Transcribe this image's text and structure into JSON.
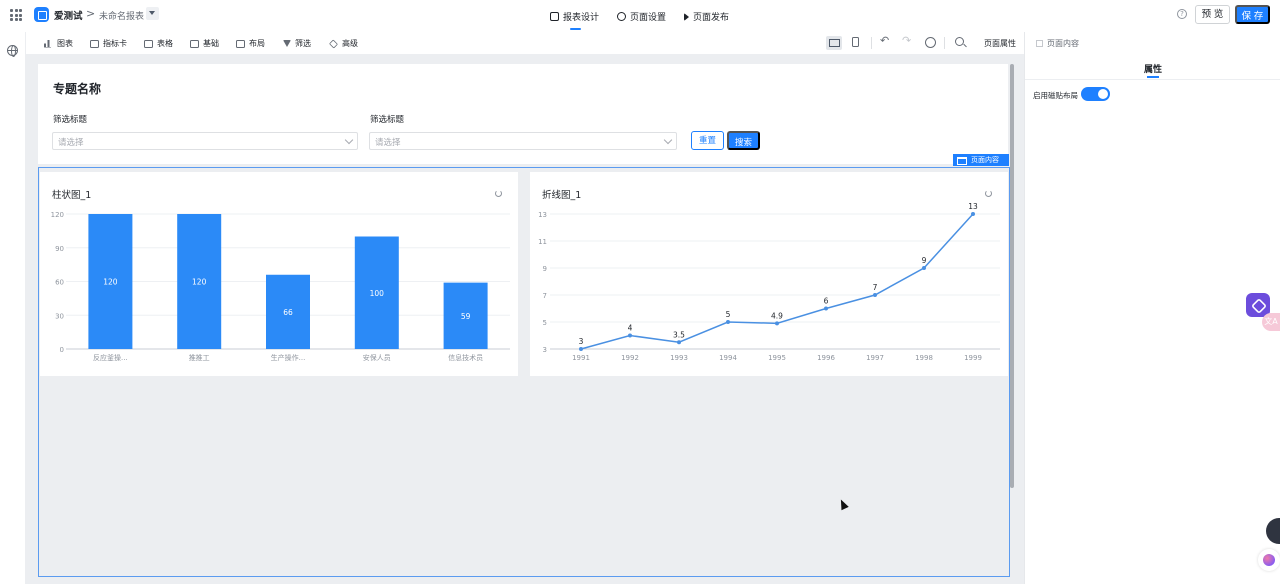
{
  "header": {
    "app_name": "爱测试",
    "breadcrumb_sep": ">",
    "report_name": "未命名报表",
    "tabs": [
      {
        "label": "报表设计",
        "icon": "report-design-icon",
        "active": true
      },
      {
        "label": "页面设置",
        "icon": "gear-icon",
        "active": false
      },
      {
        "label": "页面发布",
        "icon": "send-icon",
        "active": false
      }
    ],
    "preview_label": "预 览",
    "save_label": "保 存"
  },
  "toolbar": {
    "items": [
      {
        "label": "图表",
        "icon": "bar-chart-icon"
      },
      {
        "label": "指标卡",
        "icon": "metric-card-icon"
      },
      {
        "label": "表格",
        "icon": "table-icon"
      },
      {
        "label": "基础",
        "icon": "basic-icon"
      },
      {
        "label": "布局",
        "icon": "layout-icon"
      },
      {
        "label": "筛选",
        "icon": "filter-icon"
      },
      {
        "label": "高级",
        "icon": "layers-icon"
      }
    ],
    "page_props_label": "页面属性"
  },
  "filter_section": {
    "title": "专题名称",
    "filters": [
      {
        "label": "筛选标题",
        "placeholder": "请选择"
      },
      {
        "label": "筛选标题",
        "placeholder": "请选择"
      }
    ],
    "reset_label": "重置",
    "search_label": "搜索"
  },
  "content_tag": "页面内容",
  "right_panel": {
    "tab_label": "页面内容",
    "section_tab": "属性",
    "magnet_label": "启用磁贴布局",
    "magnet_enabled": true
  },
  "float_translate_label": "文A",
  "colors": {
    "accent": "#1e80ff",
    "bar": "#2b8af7",
    "line": "#4a90e2"
  },
  "chart_data": [
    {
      "type": "bar",
      "title": "柱状图_1",
      "categories": [
        "反应釜操...",
        "推推工",
        "生产操作...",
        "安保人员",
        "信息技术员"
      ],
      "values": [
        120,
        120,
        66,
        100,
        59
      ],
      "ylim": [
        0,
        120
      ],
      "yticks": [
        0,
        30,
        60,
        90,
        120
      ],
      "xlabel": "",
      "ylabel": "",
      "grid": true
    },
    {
      "type": "line",
      "title": "折线图_1",
      "x": [
        "1991",
        "1992",
        "1993",
        "1994",
        "1995",
        "1996",
        "1997",
        "1998",
        "1999"
      ],
      "y": [
        3,
        4,
        3.5,
        5,
        4.9,
        6,
        7,
        9,
        13
      ],
      "ylim": [
        3,
        13
      ],
      "yticks": [
        3,
        5,
        7,
        9,
        11,
        13
      ],
      "xlabel": "",
      "ylabel": "",
      "grid": true
    }
  ]
}
